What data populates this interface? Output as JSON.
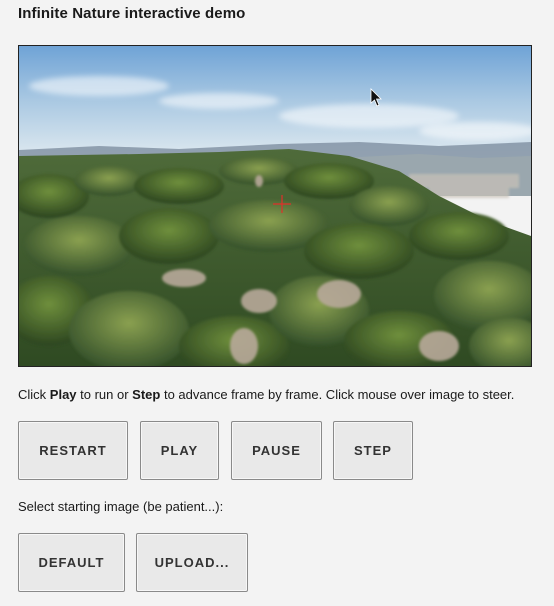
{
  "header": {
    "title": "Infinite Nature interactive demo"
  },
  "viewport": {
    "image_description_icon": "landscape-render"
  },
  "instructions": {
    "part1": "Click ",
    "play_word": "Play",
    "part2": " to run or ",
    "step_word": "Step",
    "part3": " to advance frame by frame. Click mouse over image to steer."
  },
  "controls": {
    "restart_label": "RESTART",
    "play_label": "PLAY",
    "pause_label": "PAUSE",
    "step_label": "STEP"
  },
  "start_image": {
    "label": "Select starting image (be patient...):",
    "default_label": "DEFAULT",
    "upload_label": "UPLOAD..."
  },
  "colors": {
    "sky_top": "#7fb0dc",
    "sky_horizon": "#dfe9ef",
    "foliage": "#3d5a2a",
    "crosshair": "#e0302a"
  }
}
